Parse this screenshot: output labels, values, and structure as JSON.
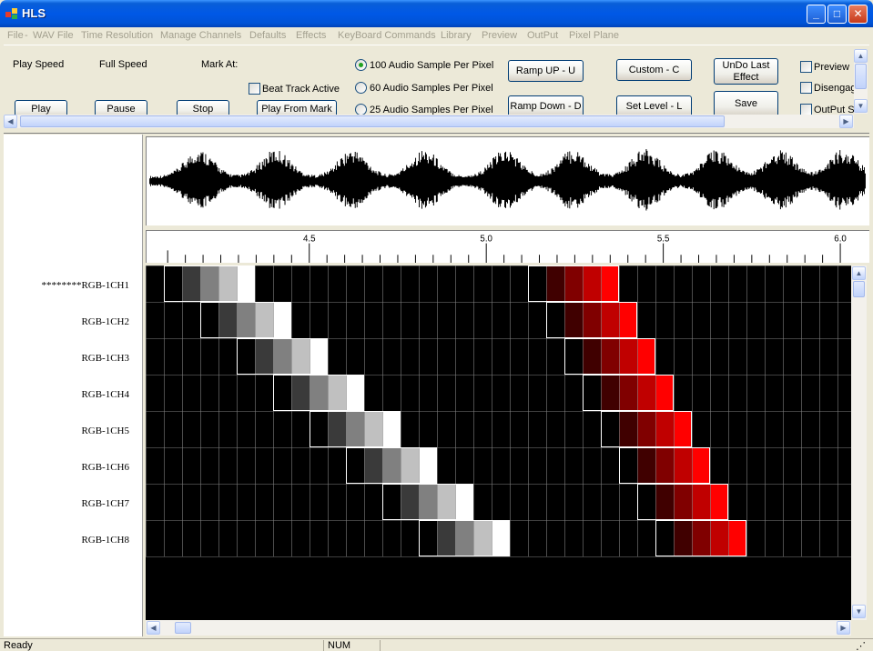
{
  "window": {
    "title": "HLS"
  },
  "menu": [
    "File",
    "WAV File",
    "Time Resolution",
    "Manage Channels",
    "Defaults",
    "Effects",
    "KeyBoard Commands",
    "Library",
    "Preview",
    "OutPut",
    "Pixel Plane"
  ],
  "toolbar": {
    "play_speed_label": "Play Speed",
    "full_speed_label": "Full Speed",
    "mark_at_label": "Mark At:",
    "play_label": "Play",
    "pause_label": "Pause",
    "stop_label": "Stop",
    "beat_track_label": "Beat Track Active",
    "play_from_mark_label": "Play From Mark",
    "resolution_options": [
      "100 Audio Sample Per Pixel",
      "60 Audio Samples Per Pixel",
      "25 Audio Samples Per Pixel"
    ],
    "resolution_selected": 0,
    "ramp_up_label": "Ramp UP - U",
    "ramp_down_label": "Ramp Down - D",
    "custom_label": "Custom - C",
    "set_level_label": "Set Level - L",
    "undo_label": "UnDo Last Effect",
    "save_label": "Save",
    "preview_label": "Preview",
    "disengage_label": "Disengag",
    "output_label": "OutPut S"
  },
  "ruler": {
    "start": 4.1,
    "end": 6.0,
    "ticks": [
      "4.5",
      "5.0",
      "5.5",
      "6.0"
    ]
  },
  "channels": [
    "********RGB-1CH1",
    "RGB-1CH2",
    "RGB-1CH3",
    "RGB-1CH4",
    "RGB-1CH5",
    "RGB-1CH6",
    "RGB-1CH7",
    "RGB-1CH8"
  ],
  "grid": {
    "columns": 39,
    "white_ramp_start_cols": [
      1,
      3,
      5,
      7,
      9,
      11,
      13,
      15
    ],
    "red_ramp_start_cols": [
      21,
      22,
      23,
      24,
      25,
      26,
      27,
      28
    ],
    "white_levels": [
      "#000000",
      "#3a3a3a",
      "#808080",
      "#c0c0c0",
      "#ffffff"
    ],
    "red_levels": [
      "#000000",
      "#400000",
      "#800000",
      "#c00000",
      "#ff0000"
    ]
  },
  "status": {
    "left": "Ready",
    "num": "NUM"
  },
  "icons": {
    "minimize": "minimize-icon",
    "maximize": "maximize-icon",
    "close": "close-icon"
  }
}
